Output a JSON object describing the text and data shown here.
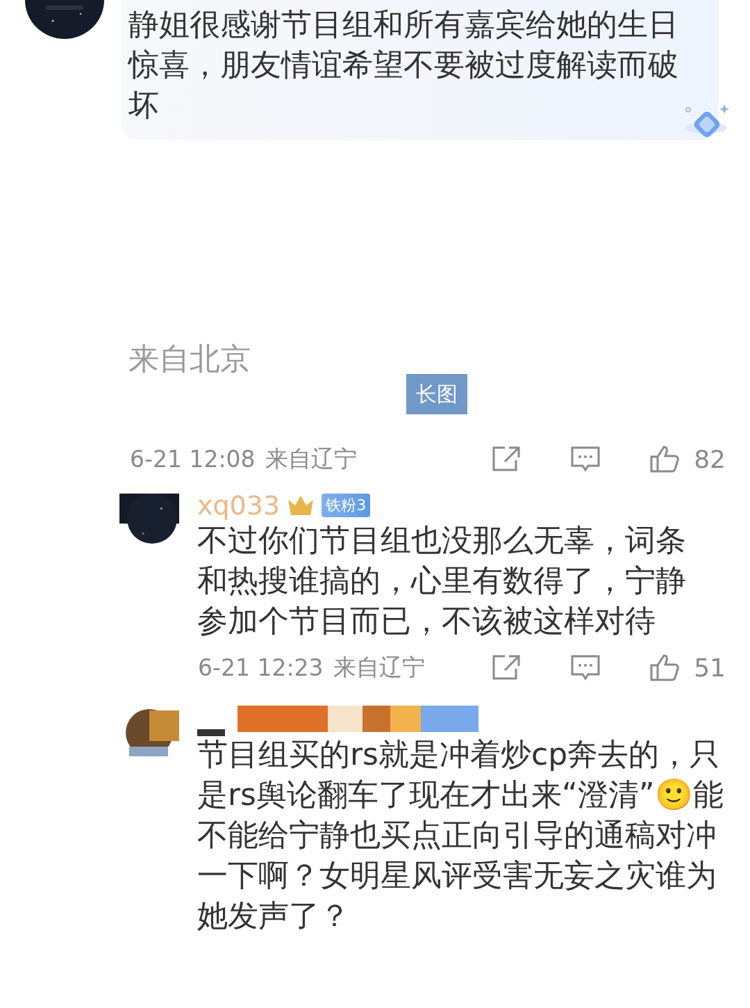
{
  "top_comment": {
    "text": "静姐很感谢节目组和所有嘉宾给她的生日惊喜，朋友情谊希望不要被过度解读而破坏"
  },
  "fragment": {
    "location": "来自北京",
    "tag": "长图"
  },
  "comment_meta": {
    "time": "6-21 12:08",
    "location": "来自辽宁",
    "likes": "82"
  },
  "replies": [
    {
      "kind": "named",
      "username": "xq033",
      "badge": "铁粉3",
      "text": "不过你们节目组也没那么无辜，词条和热搜谁搞的，心里有数得了，宁静参加个节目而已，不该被这样对待",
      "time": "6-21 12:23",
      "location": "来自辽宁",
      "likes": "51"
    },
    {
      "kind": "censored",
      "text": "节目组买的rs就是冲着炒cp奔去的，只是rs舆论翻车了现在才出来“澄清”🙂能不能给宁静也买点正向引导的通稿对冲一下啊？女明星风评受害无妄之灾谁为她发声了？"
    }
  ]
}
